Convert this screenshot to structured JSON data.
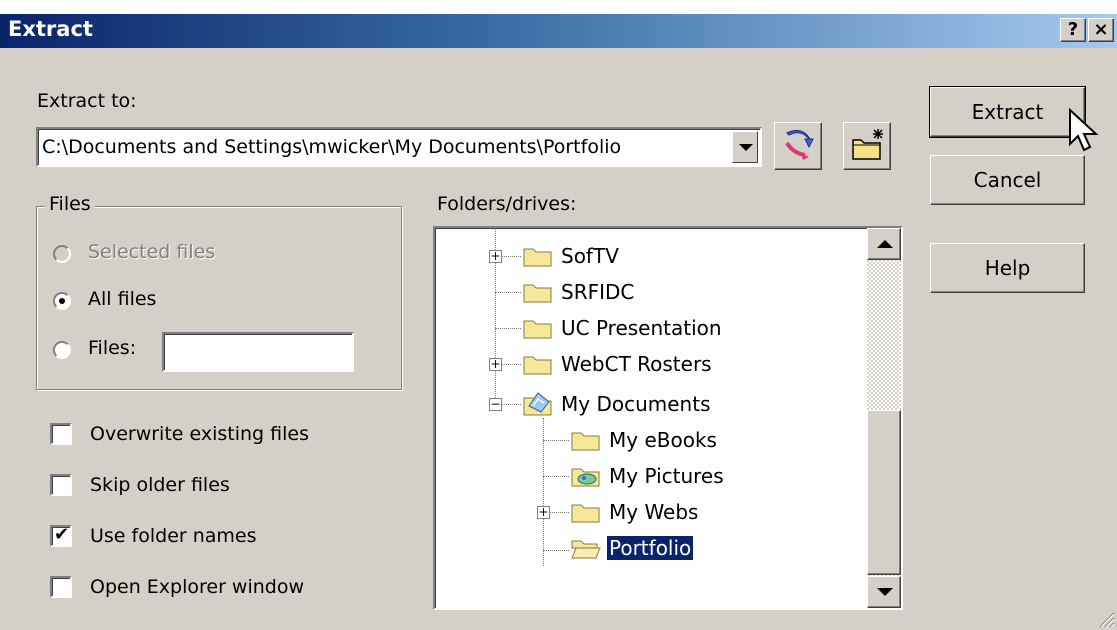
{
  "title": "Extract",
  "title_buttons": {
    "help": "?",
    "close": "×"
  },
  "extract_to_label": "Extract to:",
  "path_value": "C:\\Documents and Settings\\mwicker\\My Documents\\Portfolio",
  "buttons": {
    "extract": "Extract",
    "cancel": "Cancel",
    "help": "Help"
  },
  "files_group": {
    "label": "Files",
    "options": [
      {
        "label": "Selected files",
        "selected": false,
        "disabled": true
      },
      {
        "label": "All files",
        "selected": true,
        "disabled": false
      },
      {
        "label": "Files:",
        "selected": false,
        "disabled": false
      }
    ],
    "files_input_value": ""
  },
  "checkboxes": [
    {
      "label": "Overwrite existing files",
      "checked": false
    },
    {
      "label": "Skip older files",
      "checked": false
    },
    {
      "label": "Use folder names",
      "checked": true
    },
    {
      "label": "Open Explorer window",
      "checked": false
    }
  ],
  "folders_label": "Folders/drives:",
  "tree": [
    {
      "label": "SofTV",
      "expander": "+",
      "icon": "folder-icon"
    },
    {
      "label": "SRFIDC",
      "expander": "",
      "icon": "folder-icon"
    },
    {
      "label": "UC Presentation",
      "expander": "",
      "icon": "folder-icon"
    },
    {
      "label": "WebCT Rosters",
      "expander": "+",
      "icon": "folder-icon"
    },
    {
      "label": "My Documents",
      "expander": "−",
      "icon": "my-documents-icon"
    },
    {
      "label": "My eBooks",
      "expander": "",
      "icon": "folder-icon"
    },
    {
      "label": "My Pictures",
      "expander": "",
      "icon": "my-pictures-icon"
    },
    {
      "label": "My Webs",
      "expander": "+",
      "icon": "folder-icon"
    },
    {
      "label": "Portfolio",
      "expander": "",
      "icon": "open-folder-icon",
      "selected": true
    }
  ],
  "colors": {
    "face": "#d4d0c8",
    "title_start": "#0a246a",
    "title_end": "#a6caf0",
    "selection": "#0a246a"
  }
}
